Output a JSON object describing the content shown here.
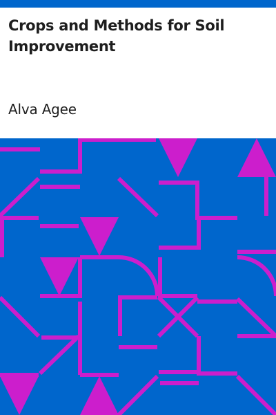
{
  "cover": {
    "title": "Crops and Methods for Soil Improvement",
    "author": "Alva Agee"
  },
  "colors": {
    "header_bar": "#0066cc",
    "pattern_background": "#0066cc",
    "pattern_lines": "#cc1ecc",
    "text": "#1e1e1e"
  }
}
